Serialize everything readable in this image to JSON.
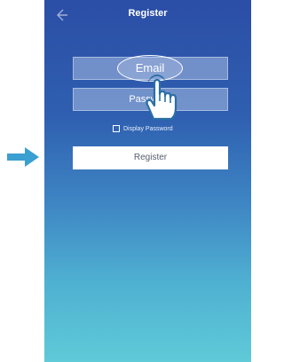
{
  "header": {
    "title": "Register"
  },
  "form": {
    "email_label": "Email",
    "password_placeholder": "Password",
    "display_password_label": "Display Password",
    "register_label": "Register"
  },
  "icons": {
    "back": "back-arrow-icon",
    "pointer_arrow": "right-arrow-icon",
    "hand": "tap-hand-icon"
  },
  "colors": {
    "pointer_arrow": "#3a9fd1",
    "background_top": "#2b4ea6",
    "background_bottom": "#5fcad8",
    "register_button_bg": "#ffffff"
  }
}
